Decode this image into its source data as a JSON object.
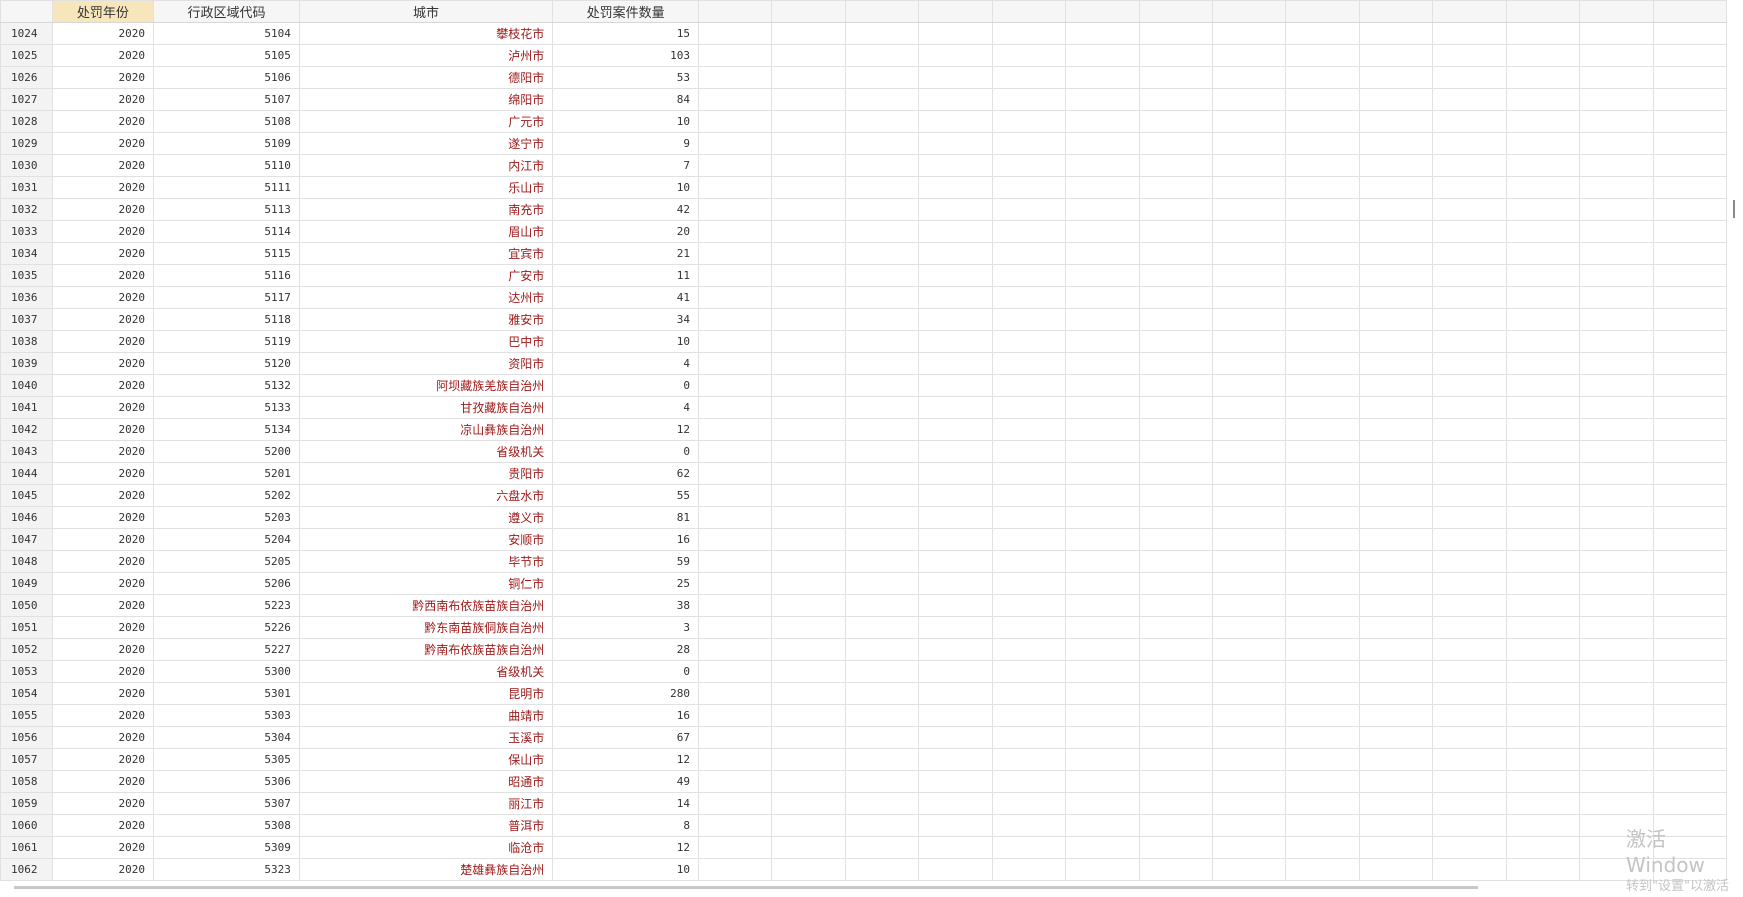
{
  "columns": [
    "处罚年份",
    "行政区域代码",
    "城市",
    "处罚案件数量"
  ],
  "rows": [
    [
      "1024",
      "2020",
      "5104",
      "攀枝花市",
      "15"
    ],
    [
      "1025",
      "2020",
      "5105",
      "泸州市",
      "103"
    ],
    [
      "1026",
      "2020",
      "5106",
      "德阳市",
      "53"
    ],
    [
      "1027",
      "2020",
      "5107",
      "绵阳市",
      "84"
    ],
    [
      "1028",
      "2020",
      "5108",
      "广元市",
      "10"
    ],
    [
      "1029",
      "2020",
      "5109",
      "遂宁市",
      "9"
    ],
    [
      "1030",
      "2020",
      "5110",
      "内江市",
      "7"
    ],
    [
      "1031",
      "2020",
      "5111",
      "乐山市",
      "10"
    ],
    [
      "1032",
      "2020",
      "5113",
      "南充市",
      "42"
    ],
    [
      "1033",
      "2020",
      "5114",
      "眉山市",
      "20"
    ],
    [
      "1034",
      "2020",
      "5115",
      "宜宾市",
      "21"
    ],
    [
      "1035",
      "2020",
      "5116",
      "广安市",
      "11"
    ],
    [
      "1036",
      "2020",
      "5117",
      "达州市",
      "41"
    ],
    [
      "1037",
      "2020",
      "5118",
      "雅安市",
      "34"
    ],
    [
      "1038",
      "2020",
      "5119",
      "巴中市",
      "10"
    ],
    [
      "1039",
      "2020",
      "5120",
      "资阳市",
      "4"
    ],
    [
      "1040",
      "2020",
      "5132",
      "阿坝藏族羌族自治州",
      "0"
    ],
    [
      "1041",
      "2020",
      "5133",
      "甘孜藏族自治州",
      "4"
    ],
    [
      "1042",
      "2020",
      "5134",
      "凉山彝族自治州",
      "12"
    ],
    [
      "1043",
      "2020",
      "5200",
      "省级机关",
      "0"
    ],
    [
      "1044",
      "2020",
      "5201",
      "贵阳市",
      "62"
    ],
    [
      "1045",
      "2020",
      "5202",
      "六盘水市",
      "55"
    ],
    [
      "1046",
      "2020",
      "5203",
      "遵义市",
      "81"
    ],
    [
      "1047",
      "2020",
      "5204",
      "安顺市",
      "16"
    ],
    [
      "1048",
      "2020",
      "5205",
      "毕节市",
      "59"
    ],
    [
      "1049",
      "2020",
      "5206",
      "铜仁市",
      "25"
    ],
    [
      "1050",
      "2020",
      "5223",
      "黔西南布依族苗族自治州",
      "38"
    ],
    [
      "1051",
      "2020",
      "5226",
      "黔东南苗族侗族自治州",
      "3"
    ],
    [
      "1052",
      "2020",
      "5227",
      "黔南布依族苗族自治州",
      "28"
    ],
    [
      "1053",
      "2020",
      "5300",
      "省级机关",
      "0"
    ],
    [
      "1054",
      "2020",
      "5301",
      "昆明市",
      "280"
    ],
    [
      "1055",
      "2020",
      "5303",
      "曲靖市",
      "16"
    ],
    [
      "1056",
      "2020",
      "5304",
      "玉溪市",
      "67"
    ],
    [
      "1057",
      "2020",
      "5305",
      "保山市",
      "12"
    ],
    [
      "1058",
      "2020",
      "5306",
      "昭通市",
      "49"
    ],
    [
      "1059",
      "2020",
      "5307",
      "丽江市",
      "14"
    ],
    [
      "1060",
      "2020",
      "5308",
      "普洱市",
      "8"
    ],
    [
      "1061",
      "2020",
      "5309",
      "临沧市",
      "12"
    ],
    [
      "1062",
      "2020",
      "5323",
      "楚雄彝族自治州",
      "10"
    ]
  ],
  "watermark": {
    "line1": "激活 Window",
    "line2": "转到\"设置\"以激活"
  }
}
